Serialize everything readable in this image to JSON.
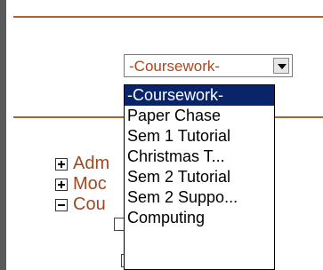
{
  "select": {
    "value": "-Coursework-",
    "options": [
      "-Coursework-",
      "Paper Chase",
      "Sem 1 Tutorial",
      "Christmas T...",
      "Sem 2 Tutorial",
      "Sem 2 Suppo...",
      "Computing"
    ],
    "selected_index": 0
  },
  "tree": {
    "items": [
      {
        "label": "Adm",
        "state": "collapsed"
      },
      {
        "label": "Moc",
        "state": "collapsed"
      },
      {
        "label": "Cou",
        "state": "expanded"
      }
    ]
  },
  "colors": {
    "accent_rule": "#b3622e",
    "select_text": "#b3451d",
    "highlight": "#0a246a",
    "tree_text": "#9c4a22"
  }
}
